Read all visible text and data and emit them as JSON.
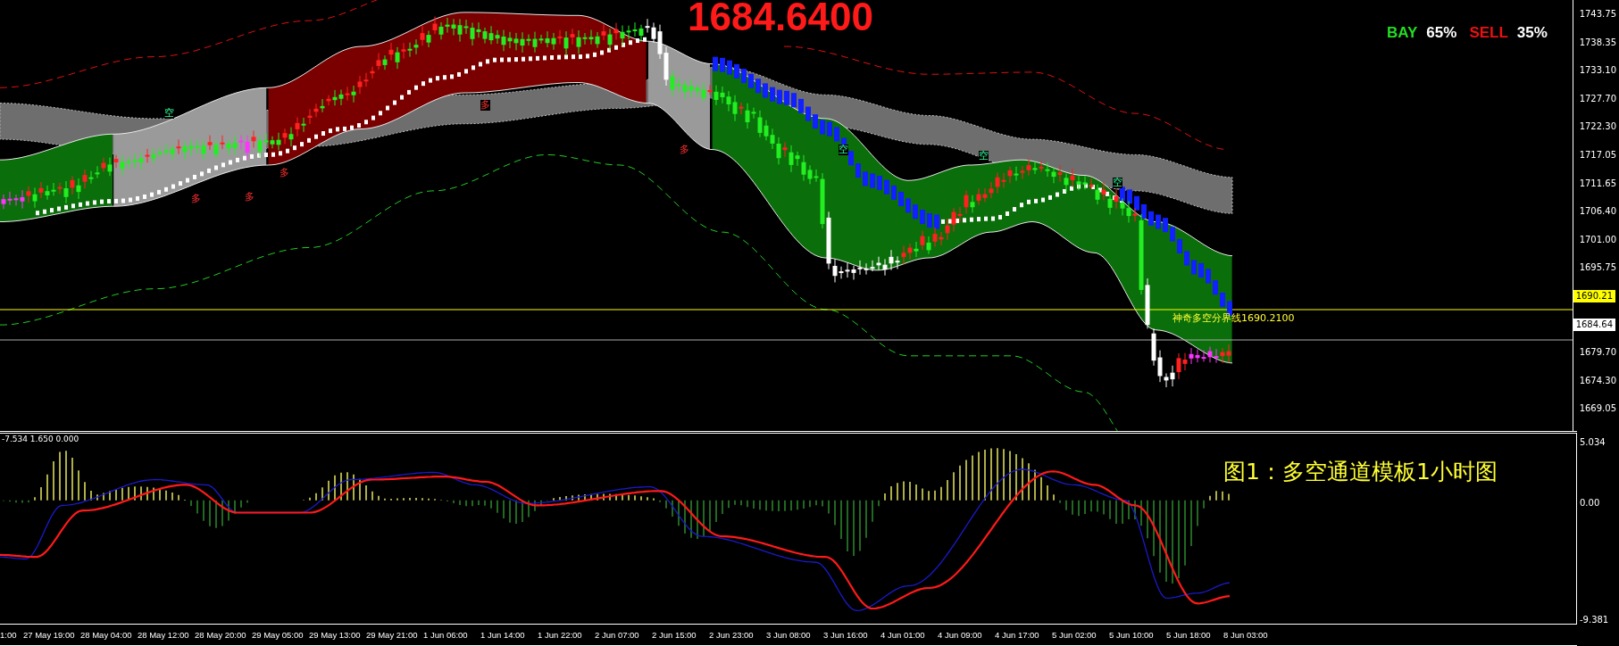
{
  "chart": {
    "price": "1684.6400",
    "sentiment": [
      {
        "label": "BAY",
        "value": "65%",
        "kind": "buy"
      },
      {
        "label": "SELL",
        "value": "35%",
        "kind": "sell"
      }
    ],
    "boundary_label": "神奇多空分界线1690.2100",
    "signal_marks": [
      {
        "text": "空",
        "kind": "short"
      },
      {
        "text": "多",
        "kind": "long"
      },
      {
        "text": "多",
        "kind": "long"
      },
      {
        "text": "多",
        "kind": "long"
      },
      {
        "text": "多",
        "kind": "long"
      },
      {
        "text": "多",
        "kind": "long"
      },
      {
        "text": "空",
        "kind": "short"
      },
      {
        "text": "空",
        "kind": "short"
      },
      {
        "text": "空",
        "kind": "short"
      }
    ],
    "price_axis": [
      {
        "text": "1743.75",
        "kind": "tick"
      },
      {
        "text": "1738.35",
        "kind": "tick"
      },
      {
        "text": "1733.10",
        "kind": "tick"
      },
      {
        "text": "1727.70",
        "kind": "tick"
      },
      {
        "text": "1722.30",
        "kind": "tick"
      },
      {
        "text": "1717.05",
        "kind": "tick"
      },
      {
        "text": "1711.65",
        "kind": "tick"
      },
      {
        "text": "1706.40",
        "kind": "tick"
      },
      {
        "text": "1701.00",
        "kind": "tick"
      },
      {
        "text": "1695.75",
        "kind": "tick"
      },
      {
        "text": "1690.21",
        "kind": "boundary"
      },
      {
        "text": "1684.64",
        "kind": "current"
      },
      {
        "text": "1679.70",
        "kind": "tick"
      },
      {
        "text": "1674.30",
        "kind": "tick"
      },
      {
        "text": "1669.05",
        "kind": "tick"
      }
    ]
  },
  "indicator": {
    "label": "-7.534 1.650 0.000",
    "axis": [
      "5.034",
      "0.00",
      "-9.381"
    ],
    "caption": "图1：多空通道模板1小时图"
  },
  "time_axis": [
    "1:00",
    "27 May 19:00",
    "28 May 04:00",
    "28 May 12:00",
    "28 May 20:00",
    "29 May 05:00",
    "29 May 13:00",
    "29 May 21:00",
    "1 Jun 06:00",
    "1 Jun 14:00",
    "1 Jun 22:00",
    "2 Jun 07:00",
    "2 Jun 15:00",
    "2 Jun 23:00",
    "3 Jun 08:00",
    "3 Jun 16:00",
    "4 Jun 01:00",
    "4 Jun 09:00",
    "4 Jun 17:00",
    "5 Jun 02:00",
    "5 Jun 10:00",
    "5 Jun 18:00",
    "8 Jun 03:00"
  ]
}
